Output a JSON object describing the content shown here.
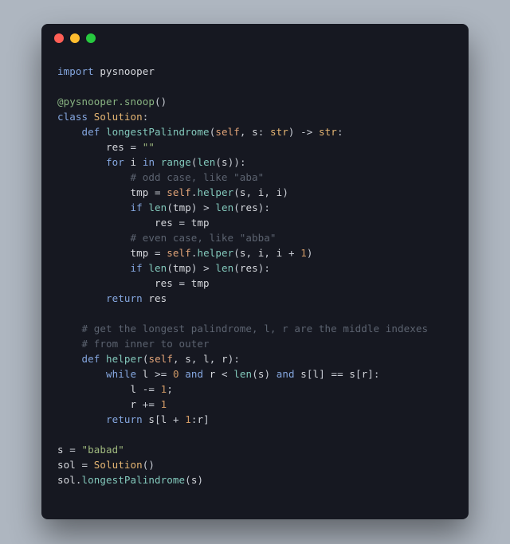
{
  "window": {
    "kind": "mac"
  },
  "code": {
    "language": "python",
    "lines": [
      {
        "tokens": [
          {
            "c": "kw",
            "t": "import"
          },
          {
            "c": "op",
            "t": " "
          },
          {
            "c": "var",
            "t": "pysnooper"
          }
        ]
      },
      {
        "tokens": []
      },
      {
        "tokens": [
          {
            "c": "dec",
            "t": "@pysnooper.snoop"
          },
          {
            "c": "op",
            "t": "()"
          }
        ]
      },
      {
        "tokens": [
          {
            "c": "kw",
            "t": "class"
          },
          {
            "c": "op",
            "t": " "
          },
          {
            "c": "cls",
            "t": "Solution"
          },
          {
            "c": "op",
            "t": ":"
          }
        ]
      },
      {
        "tokens": [
          {
            "c": "op",
            "t": "    "
          },
          {
            "c": "kw",
            "t": "def"
          },
          {
            "c": "op",
            "t": " "
          },
          {
            "c": "fn",
            "t": "longestPalindrome"
          },
          {
            "c": "op",
            "t": "("
          },
          {
            "c": "par",
            "t": "self"
          },
          {
            "c": "op",
            "t": ", "
          },
          {
            "c": "var",
            "t": "s"
          },
          {
            "c": "op",
            "t": ": "
          },
          {
            "c": "cls",
            "t": "str"
          },
          {
            "c": "op",
            "t": ") -> "
          },
          {
            "c": "cls",
            "t": "str"
          },
          {
            "c": "op",
            "t": ":"
          }
        ]
      },
      {
        "tokens": [
          {
            "c": "op",
            "t": "        "
          },
          {
            "c": "var",
            "t": "res"
          },
          {
            "c": "op",
            "t": " = "
          },
          {
            "c": "str",
            "t": "\"\""
          }
        ]
      },
      {
        "tokens": [
          {
            "c": "op",
            "t": "        "
          },
          {
            "c": "kw",
            "t": "for"
          },
          {
            "c": "op",
            "t": " "
          },
          {
            "c": "var",
            "t": "i"
          },
          {
            "c": "op",
            "t": " "
          },
          {
            "c": "kw",
            "t": "in"
          },
          {
            "c": "op",
            "t": " "
          },
          {
            "c": "fn",
            "t": "range"
          },
          {
            "c": "op",
            "t": "("
          },
          {
            "c": "fn",
            "t": "len"
          },
          {
            "c": "op",
            "t": "("
          },
          {
            "c": "var",
            "t": "s"
          },
          {
            "c": "op",
            "t": ")):"
          }
        ]
      },
      {
        "tokens": [
          {
            "c": "op",
            "t": "            "
          },
          {
            "c": "cmt",
            "t": "# odd case, like \"aba\""
          }
        ]
      },
      {
        "tokens": [
          {
            "c": "op",
            "t": "            "
          },
          {
            "c": "var",
            "t": "tmp"
          },
          {
            "c": "op",
            "t": " = "
          },
          {
            "c": "par",
            "t": "self"
          },
          {
            "c": "op",
            "t": "."
          },
          {
            "c": "fn",
            "t": "helper"
          },
          {
            "c": "op",
            "t": "("
          },
          {
            "c": "var",
            "t": "s"
          },
          {
            "c": "op",
            "t": ", "
          },
          {
            "c": "var",
            "t": "i"
          },
          {
            "c": "op",
            "t": ", "
          },
          {
            "c": "var",
            "t": "i"
          },
          {
            "c": "op",
            "t": ")"
          }
        ]
      },
      {
        "tokens": [
          {
            "c": "op",
            "t": "            "
          },
          {
            "c": "kw",
            "t": "if"
          },
          {
            "c": "op",
            "t": " "
          },
          {
            "c": "fn",
            "t": "len"
          },
          {
            "c": "op",
            "t": "("
          },
          {
            "c": "var",
            "t": "tmp"
          },
          {
            "c": "op",
            "t": ") > "
          },
          {
            "c": "fn",
            "t": "len"
          },
          {
            "c": "op",
            "t": "("
          },
          {
            "c": "var",
            "t": "res"
          },
          {
            "c": "op",
            "t": "):"
          }
        ]
      },
      {
        "tokens": [
          {
            "c": "op",
            "t": "                "
          },
          {
            "c": "var",
            "t": "res"
          },
          {
            "c": "op",
            "t": " = "
          },
          {
            "c": "var",
            "t": "tmp"
          }
        ]
      },
      {
        "tokens": [
          {
            "c": "op",
            "t": "            "
          },
          {
            "c": "cmt",
            "t": "# even case, like \"abba\""
          }
        ]
      },
      {
        "tokens": [
          {
            "c": "op",
            "t": "            "
          },
          {
            "c": "var",
            "t": "tmp"
          },
          {
            "c": "op",
            "t": " = "
          },
          {
            "c": "par",
            "t": "self"
          },
          {
            "c": "op",
            "t": "."
          },
          {
            "c": "fn",
            "t": "helper"
          },
          {
            "c": "op",
            "t": "("
          },
          {
            "c": "var",
            "t": "s"
          },
          {
            "c": "op",
            "t": ", "
          },
          {
            "c": "var",
            "t": "i"
          },
          {
            "c": "op",
            "t": ", "
          },
          {
            "c": "var",
            "t": "i"
          },
          {
            "c": "op",
            "t": " + "
          },
          {
            "c": "num",
            "t": "1"
          },
          {
            "c": "op",
            "t": ")"
          }
        ]
      },
      {
        "tokens": [
          {
            "c": "op",
            "t": "            "
          },
          {
            "c": "kw",
            "t": "if"
          },
          {
            "c": "op",
            "t": " "
          },
          {
            "c": "fn",
            "t": "len"
          },
          {
            "c": "op",
            "t": "("
          },
          {
            "c": "var",
            "t": "tmp"
          },
          {
            "c": "op",
            "t": ") > "
          },
          {
            "c": "fn",
            "t": "len"
          },
          {
            "c": "op",
            "t": "("
          },
          {
            "c": "var",
            "t": "res"
          },
          {
            "c": "op",
            "t": "):"
          }
        ]
      },
      {
        "tokens": [
          {
            "c": "op",
            "t": "                "
          },
          {
            "c": "var",
            "t": "res"
          },
          {
            "c": "op",
            "t": " = "
          },
          {
            "c": "var",
            "t": "tmp"
          }
        ]
      },
      {
        "tokens": [
          {
            "c": "op",
            "t": "        "
          },
          {
            "c": "kw",
            "t": "return"
          },
          {
            "c": "op",
            "t": " "
          },
          {
            "c": "var",
            "t": "res"
          }
        ]
      },
      {
        "tokens": []
      },
      {
        "tokens": [
          {
            "c": "op",
            "t": "    "
          },
          {
            "c": "cmt",
            "t": "# get the longest palindrome, l, r are the middle indexes"
          }
        ]
      },
      {
        "tokens": [
          {
            "c": "op",
            "t": "    "
          },
          {
            "c": "cmt",
            "t": "# from inner to outer"
          }
        ]
      },
      {
        "tokens": [
          {
            "c": "op",
            "t": "    "
          },
          {
            "c": "kw",
            "t": "def"
          },
          {
            "c": "op",
            "t": " "
          },
          {
            "c": "fn",
            "t": "helper"
          },
          {
            "c": "op",
            "t": "("
          },
          {
            "c": "par",
            "t": "self"
          },
          {
            "c": "op",
            "t": ", "
          },
          {
            "c": "var",
            "t": "s"
          },
          {
            "c": "op",
            "t": ", "
          },
          {
            "c": "var",
            "t": "l"
          },
          {
            "c": "op",
            "t": ", "
          },
          {
            "c": "var",
            "t": "r"
          },
          {
            "c": "op",
            "t": "):"
          }
        ]
      },
      {
        "tokens": [
          {
            "c": "op",
            "t": "        "
          },
          {
            "c": "kw",
            "t": "while"
          },
          {
            "c": "op",
            "t": " "
          },
          {
            "c": "var",
            "t": "l"
          },
          {
            "c": "op",
            "t": " >= "
          },
          {
            "c": "num",
            "t": "0"
          },
          {
            "c": "op",
            "t": " "
          },
          {
            "c": "kw",
            "t": "and"
          },
          {
            "c": "op",
            "t": " "
          },
          {
            "c": "var",
            "t": "r"
          },
          {
            "c": "op",
            "t": " < "
          },
          {
            "c": "fn",
            "t": "len"
          },
          {
            "c": "op",
            "t": "("
          },
          {
            "c": "var",
            "t": "s"
          },
          {
            "c": "op",
            "t": ") "
          },
          {
            "c": "kw",
            "t": "and"
          },
          {
            "c": "op",
            "t": " "
          },
          {
            "c": "var",
            "t": "s"
          },
          {
            "c": "op",
            "t": "["
          },
          {
            "c": "var",
            "t": "l"
          },
          {
            "c": "op",
            "t": "] == "
          },
          {
            "c": "var",
            "t": "s"
          },
          {
            "c": "op",
            "t": "["
          },
          {
            "c": "var",
            "t": "r"
          },
          {
            "c": "op",
            "t": "]:"
          }
        ]
      },
      {
        "tokens": [
          {
            "c": "op",
            "t": "            "
          },
          {
            "c": "var",
            "t": "l"
          },
          {
            "c": "op",
            "t": " -= "
          },
          {
            "c": "num",
            "t": "1"
          },
          {
            "c": "op",
            "t": ";"
          }
        ]
      },
      {
        "tokens": [
          {
            "c": "op",
            "t": "            "
          },
          {
            "c": "var",
            "t": "r"
          },
          {
            "c": "op",
            "t": " += "
          },
          {
            "c": "num",
            "t": "1"
          }
        ]
      },
      {
        "tokens": [
          {
            "c": "op",
            "t": "        "
          },
          {
            "c": "kw",
            "t": "return"
          },
          {
            "c": "op",
            "t": " "
          },
          {
            "c": "var",
            "t": "s"
          },
          {
            "c": "op",
            "t": "["
          },
          {
            "c": "var",
            "t": "l"
          },
          {
            "c": "op",
            "t": " + "
          },
          {
            "c": "num",
            "t": "1"
          },
          {
            "c": "op",
            "t": ":"
          },
          {
            "c": "var",
            "t": "r"
          },
          {
            "c": "op",
            "t": "]"
          }
        ]
      },
      {
        "tokens": []
      },
      {
        "tokens": [
          {
            "c": "var",
            "t": "s"
          },
          {
            "c": "op",
            "t": " = "
          },
          {
            "c": "str",
            "t": "\"babad\""
          }
        ]
      },
      {
        "tokens": [
          {
            "c": "var",
            "t": "sol"
          },
          {
            "c": "op",
            "t": " = "
          },
          {
            "c": "cls",
            "t": "Solution"
          },
          {
            "c": "op",
            "t": "()"
          }
        ]
      },
      {
        "tokens": [
          {
            "c": "var",
            "t": "sol"
          },
          {
            "c": "op",
            "t": "."
          },
          {
            "c": "fn",
            "t": "longestPalindrome"
          },
          {
            "c": "op",
            "t": "("
          },
          {
            "c": "var",
            "t": "s"
          },
          {
            "c": "op",
            "t": ")"
          }
        ]
      }
    ]
  }
}
